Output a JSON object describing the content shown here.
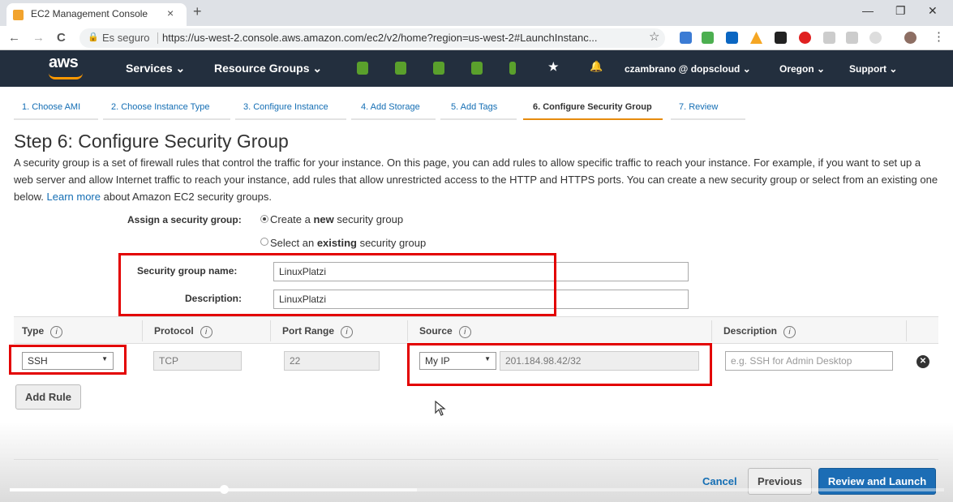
{
  "browser": {
    "tab_title": "EC2 Management Console",
    "tab_close": "×",
    "new_tab": "+",
    "minimize": "—",
    "restore": "❐",
    "close": "✕",
    "back": "←",
    "forward": "→",
    "reload": "C",
    "secure_label": "Es seguro",
    "url": "https://us-west-2.console.aws.amazon.com/ec2/v2/home?region=us-west-2#LaunchInstanc...",
    "star": "☆",
    "menu": "⋮"
  },
  "aws_nav": {
    "logo": "aws",
    "services": "Services ⌄",
    "resource_groups": "Resource Groups ⌄",
    "user": "czambrano @ dopscloud ⌄",
    "region": "Oregon ⌄",
    "support": "Support ⌄",
    "pin_icon": "★",
    "bell_icon": "🔔"
  },
  "wizard": {
    "steps": [
      "1. Choose AMI",
      "2. Choose Instance Type",
      "3. Configure Instance",
      "4. Add Storage",
      "5. Add Tags",
      "6. Configure Security Group",
      "7. Review"
    ],
    "active_step_index": 5
  },
  "page": {
    "title": "Step 6: Configure Security Group",
    "description_before_link": "A security group is a set of firewall rules that control the traffic for your instance. On this page, you can add rules to allow specific traffic to reach your instance. For example, if you want to set up a web server and allow Internet traffic to reach your instance, add rules that allow unrestricted access to the HTTP and HTTPS ports. You can create a new security group or select from an existing one below.",
    "learn_more": "Learn more",
    "description_after_link": "about Amazon EC2 security groups."
  },
  "assign": {
    "label": "Assign a security group:",
    "option_create_pre": "Create a ",
    "option_create_bold": "new",
    "option_create_post": " security group",
    "option_existing_pre": "Select an ",
    "option_existing_bold": "existing",
    "option_existing_post": " security group",
    "selected": "create"
  },
  "group": {
    "name_label": "Security group name:",
    "name_value": "LinuxPlatzi",
    "description_label": "Description:",
    "description_value": "LinuxPlatzi"
  },
  "rules_table": {
    "headers": [
      "Type",
      "Protocol",
      "Port Range",
      "Source",
      "Description"
    ],
    "info_icon": "i",
    "rows": [
      {
        "type": "SSH",
        "protocol": "TCP",
        "port_range": "22",
        "source_select": "My IP",
        "source_cidr": "201.184.98.42/32",
        "description_placeholder": "e.g. SSH for Admin Desktop",
        "remove_icon": "✕"
      }
    ]
  },
  "buttons": {
    "add_rule": "Add Rule",
    "cancel": "Cancel",
    "previous": "Previous",
    "review_and_launch": "Review and Launch"
  },
  "video": {
    "progress": 0.229
  },
  "colors": {
    "aws_nav_bg": "#232f3e",
    "aws_orange": "#ff9900",
    "link_blue": "#146eb4",
    "active_step": "#e68b0e",
    "highlight_red": "#e30000",
    "primary_button": "#1c6db5"
  }
}
